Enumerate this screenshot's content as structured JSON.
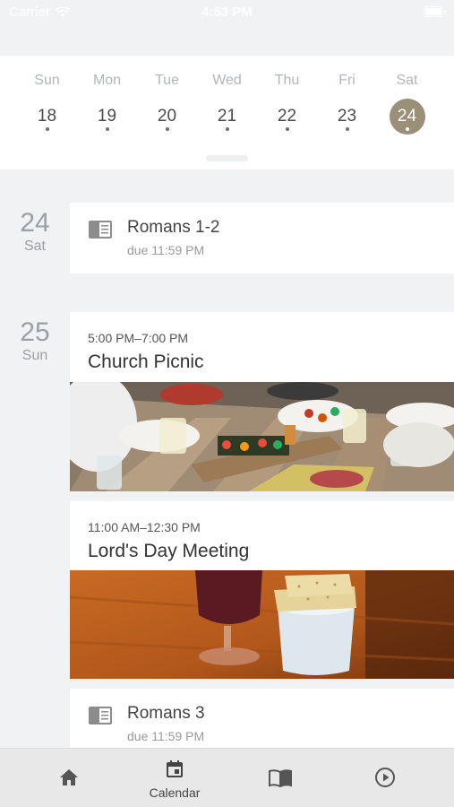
{
  "status_bar": {
    "carrier": "Carrier",
    "time": "4:53 PM"
  },
  "week": {
    "days": [
      {
        "name": "Sun",
        "num": "18",
        "selected": false
      },
      {
        "name": "Mon",
        "num": "19",
        "selected": false
      },
      {
        "name": "Tue",
        "num": "20",
        "selected": false
      },
      {
        "name": "Wed",
        "num": "21",
        "selected": false
      },
      {
        "name": "Thu",
        "num": "22",
        "selected": false
      },
      {
        "name": "Fri",
        "num": "23",
        "selected": false
      },
      {
        "name": "Sat",
        "num": "24",
        "selected": true
      }
    ],
    "selected_color": "#9a8f78"
  },
  "agenda": {
    "day1": {
      "num": "24",
      "weekday": "Sat"
    },
    "day2": {
      "num": "25",
      "weekday": "Sun"
    },
    "reading1": {
      "title": "Romans 1-2",
      "due": "due 11:59 PM",
      "icon": "book-icon"
    },
    "event1": {
      "time": "5:00 PM–7:00 PM",
      "title": "Church Picnic"
    },
    "event2": {
      "time": "11:00 AM–12:30 PM",
      "title": "Lord's Day Meeting"
    },
    "reading2": {
      "title": "Romans 3",
      "due": "due 11:59 PM",
      "icon": "book-icon"
    }
  },
  "tabbar": {
    "tabs": [
      {
        "icon": "home-icon",
        "label": ""
      },
      {
        "icon": "calendar-icon",
        "label": "Calendar"
      },
      {
        "icon": "open-book-icon",
        "label": ""
      },
      {
        "icon": "play-circle-icon",
        "label": ""
      }
    ]
  }
}
